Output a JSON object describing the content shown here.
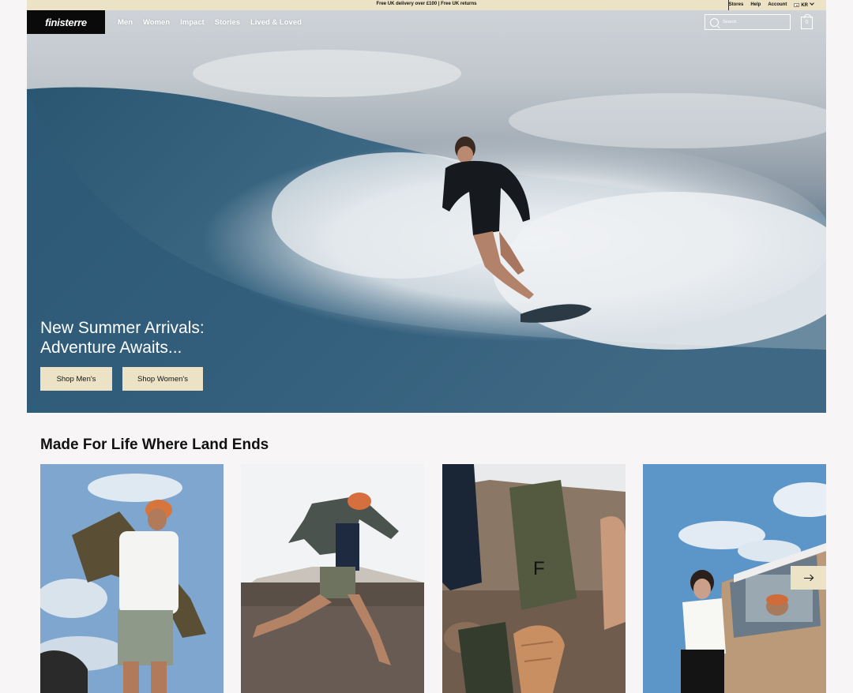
{
  "announcement": {
    "text": "Free UK delivery over £100 | Free UK returns"
  },
  "utility": {
    "stores": "Stores",
    "help": "Help",
    "account": "Account",
    "region": "KR"
  },
  "brand": {
    "logo_text": "finisterre"
  },
  "nav": {
    "items": [
      "Men",
      "Women",
      "Impact",
      "Stories",
      "Lived & Loved"
    ]
  },
  "search": {
    "placeholder": "Search"
  },
  "cart": {
    "count": "0"
  },
  "hero": {
    "heading_line1": "New Summer Arrivals:",
    "heading_line2": "Adventure Awaits...",
    "cta_men": "Shop Men's",
    "cta_women": "Shop Women's"
  },
  "section": {
    "title": "Made For Life Where Land Ends"
  },
  "colors": {
    "accent": "#ece3c6",
    "logo_bg": "#0a0a0a",
    "page_bg": "#f7f5f5"
  }
}
